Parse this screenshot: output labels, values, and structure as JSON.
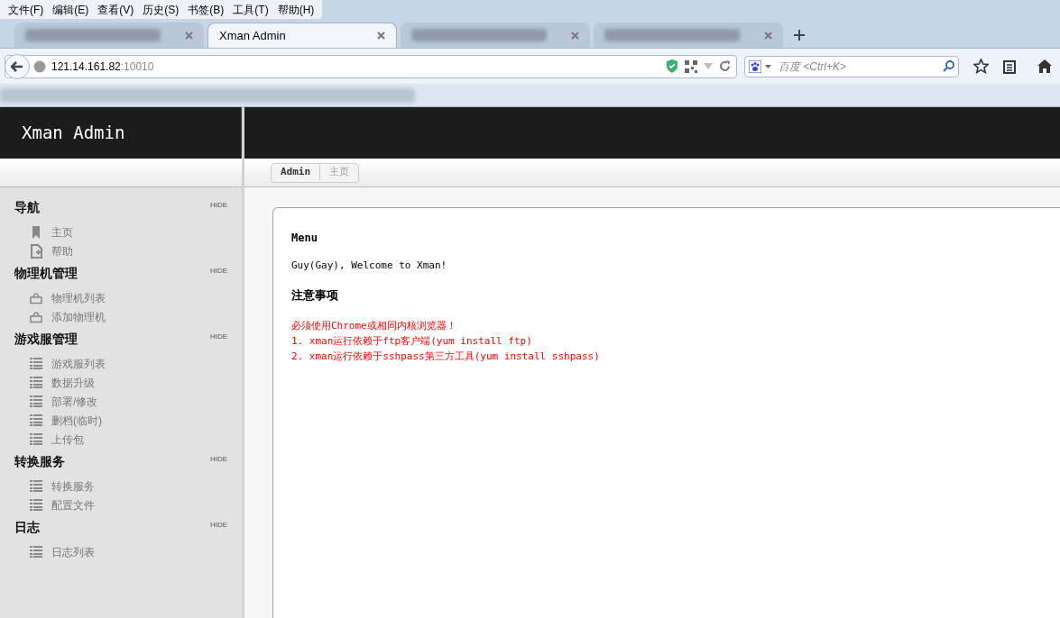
{
  "menu_bar": [
    "文件(F)",
    "编辑(E)",
    "查看(V)",
    "历史(S)",
    "书签(B)",
    "工具(T)",
    "帮助(H)"
  ],
  "tabs": [
    {
      "kind": "blurred",
      "selected": false
    },
    {
      "kind": "text",
      "label": "Xman Admin",
      "selected": true
    },
    {
      "kind": "blurred",
      "selected": false
    },
    {
      "kind": "blurred",
      "selected": false
    }
  ],
  "address": {
    "host": "121.14.161.82",
    "port": ":10010"
  },
  "search": {
    "placeholder": "百度 <Ctrl+K>"
  },
  "app": {
    "title": "Xman Admin",
    "breadcrumb": [
      "Admin",
      "主页"
    ]
  },
  "sidebar": [
    {
      "title": "导航",
      "hide": "HIDE",
      "items": [
        {
          "kind": "bookmark",
          "label": "主页"
        },
        {
          "kind": "doc",
          "label": "帮助"
        }
      ]
    },
    {
      "title": "物理机管理",
      "hide": "HIDE",
      "items": [
        {
          "kind": "box",
          "label": "物理机列表"
        },
        {
          "kind": "box",
          "label": "添加物理机"
        }
      ]
    },
    {
      "title": "游戏服管理",
      "hide": "HIDE",
      "items": [
        {
          "kind": "list",
          "label": "游戏服列表"
        },
        {
          "kind": "list",
          "label": "数据升级"
        },
        {
          "kind": "list",
          "label": "部署/修改"
        },
        {
          "kind": "list",
          "label": "删档(临时)"
        },
        {
          "kind": "list",
          "label": "上传包"
        }
      ]
    },
    {
      "title": "转换服务",
      "hide": "HIDE",
      "items": [
        {
          "kind": "list",
          "label": "转换服务"
        },
        {
          "kind": "list",
          "label": "配置文件"
        }
      ]
    },
    {
      "title": "日志",
      "hide": "HIDE",
      "items": [
        {
          "kind": "list",
          "label": "日志列表"
        }
      ]
    }
  ],
  "content": {
    "heading": "Menu",
    "welcome": "Guy(Gay), Welcome to Xman!",
    "notes_heading": "注意事项",
    "notes": [
      "必须使用Chrome或相同内核浏览器！",
      "1. xman运行依赖于ftp客户端(yum install ftp)",
      "2. xman运行依赖于sshpass第三方工具(yum install sshpass)"
    ]
  }
}
